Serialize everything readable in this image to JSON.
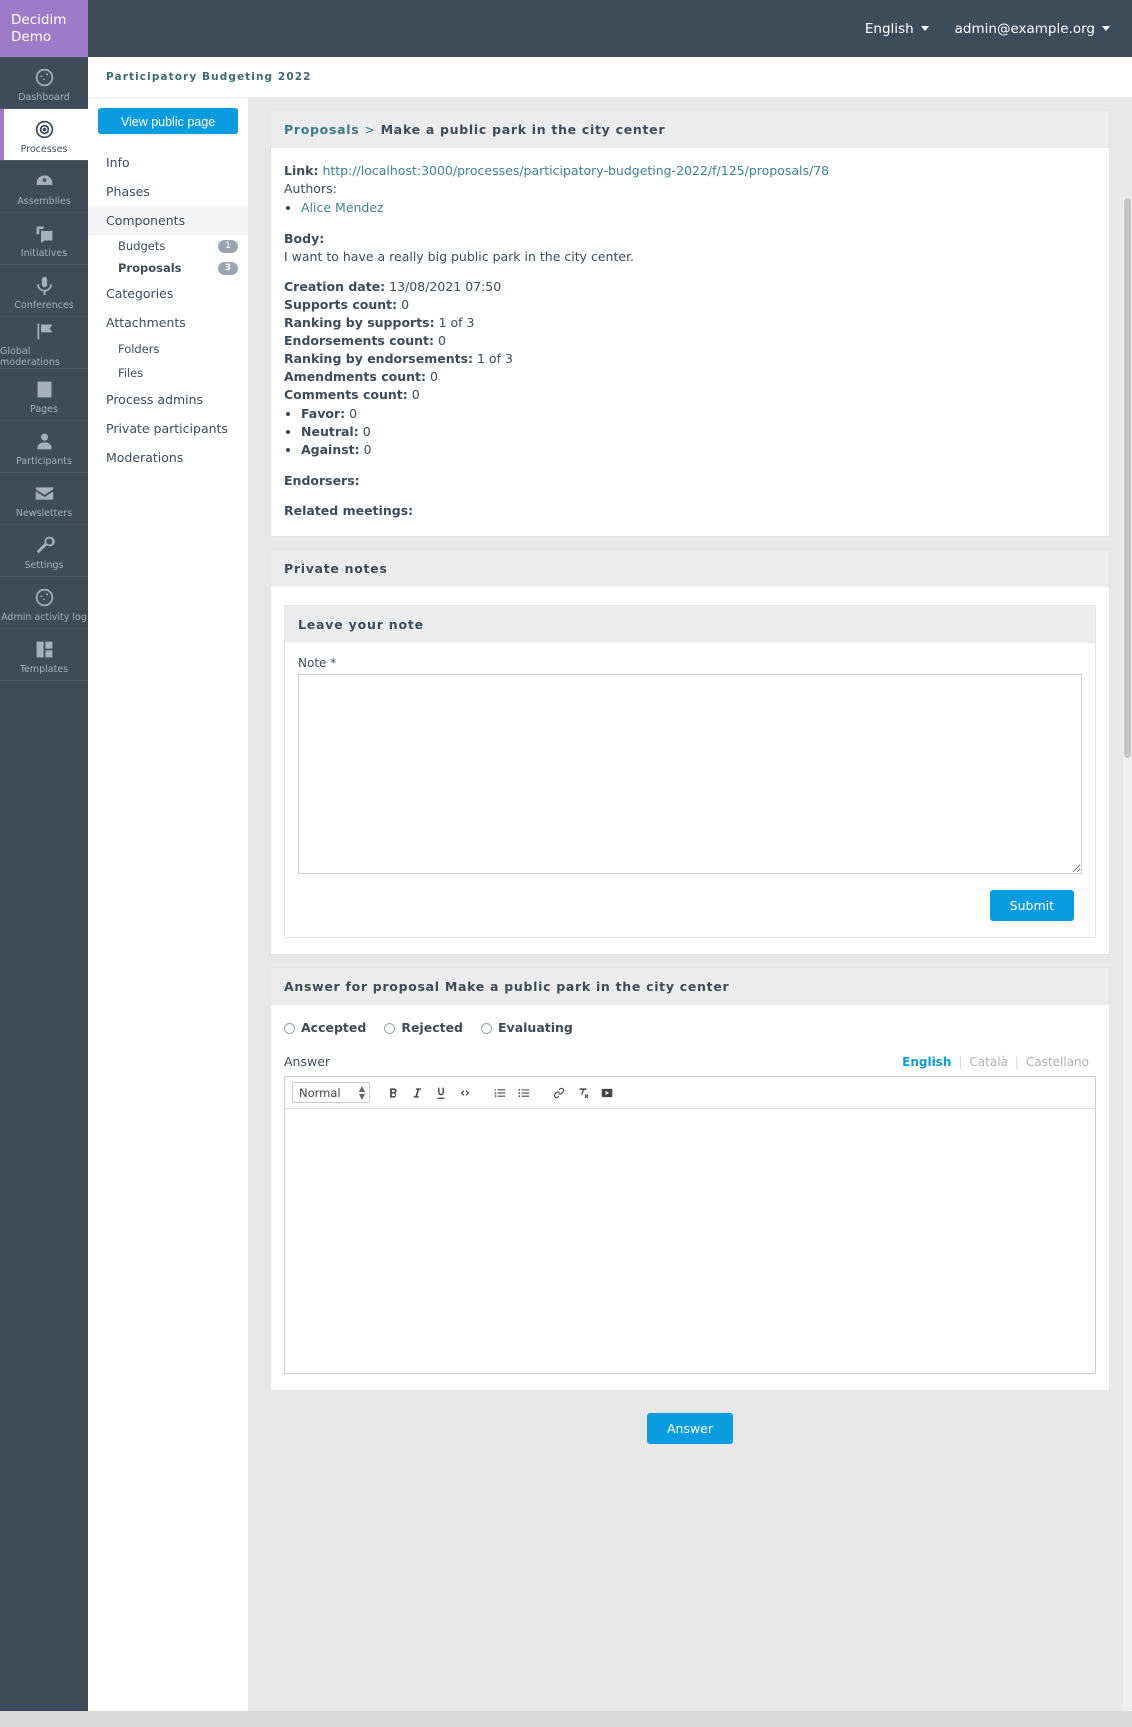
{
  "brand": {
    "line1": "Decidim",
    "line2": "Demo",
    "color": "#9d7bc8"
  },
  "topbar": {
    "language": "English",
    "account": "admin@example.org"
  },
  "rail": {
    "items": [
      {
        "label": "Dashboard",
        "icon": "dashboard-icon",
        "active": false
      },
      {
        "label": "Processes",
        "icon": "target-icon",
        "active": true
      },
      {
        "label": "Assemblies",
        "icon": "assembly-icon",
        "active": false
      },
      {
        "label": "Initiatives",
        "icon": "initiatives-icon",
        "active": false
      },
      {
        "label": "Conferences",
        "icon": "microphone-icon",
        "active": false
      },
      {
        "label": "Global moderations",
        "icon": "flag-icon",
        "active": false
      },
      {
        "label": "Pages",
        "icon": "book-icon",
        "active": false
      },
      {
        "label": "Participants",
        "icon": "user-icon",
        "active": false
      },
      {
        "label": "Newsletters",
        "icon": "envelope-icon",
        "active": false
      },
      {
        "label": "Settings",
        "icon": "wrench-icon",
        "active": false
      },
      {
        "label": "Admin activity log",
        "icon": "activity-log-icon",
        "active": false
      },
      {
        "label": "Templates",
        "icon": "templates-icon",
        "active": false
      }
    ]
  },
  "process": {
    "title": "Participatory Budgeting 2022",
    "view_public_label": "View public page",
    "nav": {
      "info": "Info",
      "phases": "Phases",
      "components": "Components",
      "budgets": "Budgets",
      "budgets_count": "1",
      "proposals": "Proposals",
      "proposals_count": "3",
      "categories": "Categories",
      "attachments": "Attachments",
      "folders": "Folders",
      "files": "Files",
      "process_admins": "Process admins",
      "private_participants": "Private participants",
      "moderations": "Moderations"
    }
  },
  "proposal": {
    "breadcrumb_parent": "Proposals",
    "breadcrumb_sep": ">",
    "title": "Make a public park in the city center",
    "link_label": "Link:",
    "link_url": "http://localhost:3000/processes/participatory-budgeting-2022/f/125/proposals/78",
    "authors_label": "Authors:",
    "authors": [
      "Alice Mendez"
    ],
    "body_label": "Body:",
    "body_text": "I want to have a really big public park in the city center.",
    "creation_date_label": "Creation date:",
    "creation_date": "13/08/2021 07:50",
    "supports_label": "Supports count:",
    "supports": "0",
    "ranking_supports_label": "Ranking by supports:",
    "ranking_supports": "1 of 3",
    "endorsements_label": "Endorsements count:",
    "endorsements": "0",
    "ranking_endorsements_label": "Ranking by endorsements:",
    "ranking_endorsements": "1 of 3",
    "amendments_label": "Amendments count:",
    "amendments": "0",
    "comments_label": "Comments count:",
    "comments": "0",
    "favor_label": "Favor:",
    "favor": "0",
    "neutral_label": "Neutral:",
    "neutral": "0",
    "against_label": "Against:",
    "against": "0",
    "endorsers_label": "Endorsers:",
    "related_meetings_label": "Related meetings:"
  },
  "private_notes": {
    "section_title": "Private notes",
    "form_title": "Leave your note",
    "note_label": "Note *",
    "note_value": "",
    "note_placeholder": "",
    "submit_label": "Submit"
  },
  "answer": {
    "section_title": "Answer for proposal Make a public park in the city center",
    "options": [
      {
        "label": "Accepted",
        "selected": false
      },
      {
        "label": "Rejected",
        "selected": false
      },
      {
        "label": "Evaluating",
        "selected": false
      }
    ],
    "answer_label": "Answer",
    "locales": [
      {
        "label": "English",
        "active": true
      },
      {
        "label": "Català",
        "active": false
      },
      {
        "label": "Castellano",
        "active": false
      }
    ],
    "editor": {
      "block_format": "Normal",
      "buttons": [
        "bold-icon",
        "italic-icon",
        "underline-icon",
        "code-icon",
        "ordered-list-icon",
        "bullet-list-icon",
        "link-icon",
        "clear-format-icon",
        "video-icon"
      ],
      "content": ""
    },
    "submit_label": "Answer"
  },
  "colors": {
    "accent": "#0a9ce0",
    "dark": "#3e4b5b",
    "brand": "#9d7bc8",
    "teal": "#3d6b75"
  }
}
